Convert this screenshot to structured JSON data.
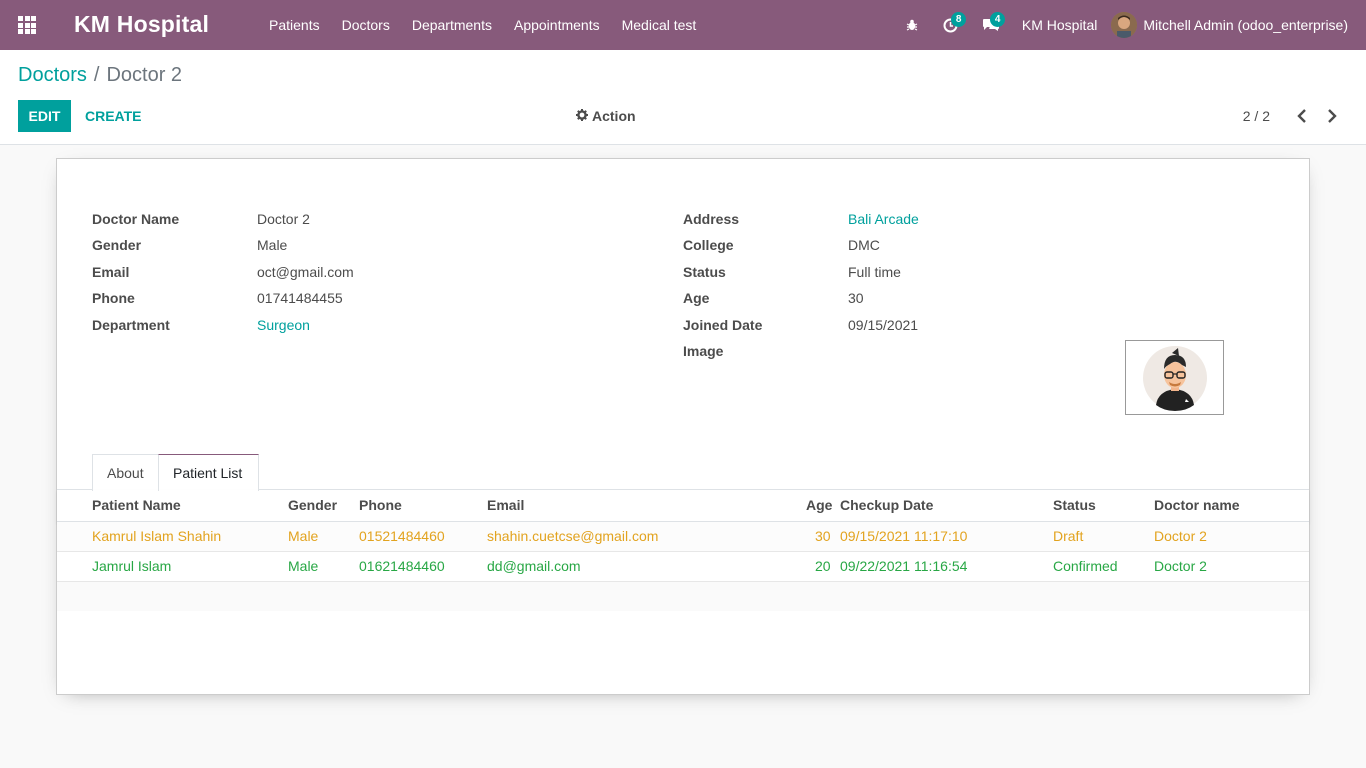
{
  "navbar": {
    "brand": "KM Hospital",
    "menu": [
      "Patients",
      "Doctors",
      "Departments",
      "Appointments",
      "Medical test"
    ],
    "activity_count": "8",
    "message_count": "4",
    "company": "KM Hospital",
    "user": "Mitchell Admin (odoo_enterprise)"
  },
  "breadcrumb": {
    "parent": "Doctors",
    "separator": "/",
    "current": "Doctor 2"
  },
  "toolbar": {
    "edit_label": "EDIT",
    "create_label": "CREATE",
    "action_label": "Action",
    "pager": "2 / 2"
  },
  "form": {
    "left": [
      {
        "label": "Doctor Name",
        "value": "Doctor 2"
      },
      {
        "label": "Gender",
        "value": "Male"
      },
      {
        "label": "Email",
        "value": "oct@gmail.com"
      },
      {
        "label": "Phone",
        "value": "01741484455"
      },
      {
        "label": "Department",
        "value": "Surgeon"
      }
    ],
    "right": [
      {
        "label": "Address",
        "value": "Bali Arcade"
      },
      {
        "label": "College",
        "value": "DMC"
      },
      {
        "label": "Status",
        "value": "Full time"
      },
      {
        "label": "Age",
        "value": "30"
      },
      {
        "label": "Joined Date",
        "value": "09/15/2021"
      },
      {
        "label": "Image",
        "value": ""
      }
    ]
  },
  "tabs": [
    "About",
    "Patient List"
  ],
  "table": {
    "headers": [
      "Patient Name",
      "Gender",
      "Phone",
      "Email",
      "Age",
      "Checkup Date",
      "Status",
      "Doctor name"
    ],
    "rows": [
      [
        "Kamrul Islam Shahin",
        "Male",
        "01521484460",
        "shahin.cuetcse@gmail.com",
        "30",
        "09/15/2021 11:17:10",
        "Draft",
        "Doctor 2"
      ],
      [
        "Jamrul Islam",
        "Male",
        "01621484460",
        "dd@gmail.com",
        "20",
        "09/22/2021 11:16:54",
        "Confirmed",
        "Doctor 2"
      ]
    ]
  },
  "colors": {
    "brand": "#875a7b",
    "accent": "#00a09d",
    "draft": "#e2a31f",
    "confirmed": "#28a745"
  },
  "icons": [
    "apps-icon",
    "bug-icon",
    "clock-icon",
    "chat-icon",
    "gear-icon",
    "chevron-left-icon",
    "chevron-right-icon"
  ]
}
